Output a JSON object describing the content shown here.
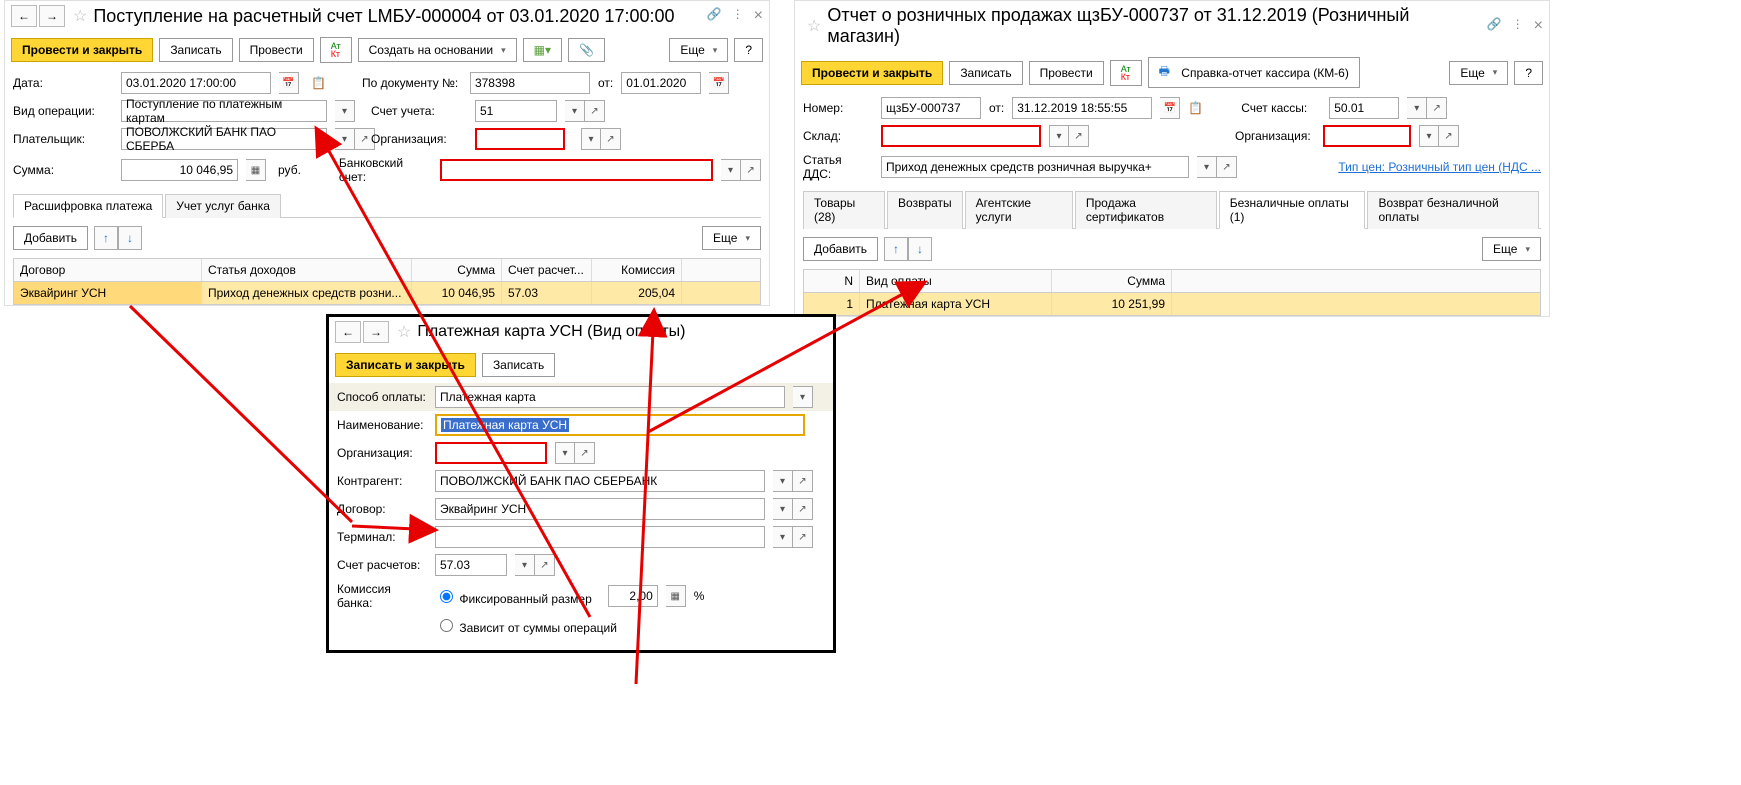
{
  "left": {
    "title": "Поступление на расчетный счет LMБУ-000004 от 03.01.2020 17:00:00",
    "toolbar": {
      "post_close": "Провести и закрыть",
      "write": "Записать",
      "post": "Провести",
      "create_based": "Создать на основании",
      "more": "Еще",
      "help": "?"
    },
    "fields": {
      "date_label": "Дата:",
      "date": "03.01.2020 17:00:00",
      "docnum_label": "По документу №:",
      "docnum": "378398",
      "docfrom_label": "от:",
      "docfrom": "01.01.2020",
      "optype_label": "Вид операции:",
      "optype": "Поступление по платежным картам",
      "acct_label": "Счет учета:",
      "acct": "51",
      "payer_label": "Плательщик:",
      "payer": "ПОВОЛЖСКИЙ БАНК ПАО СБЕРБА",
      "org_label": "Организация:",
      "amount_label": "Сумма:",
      "amount": "10 046,95",
      "currency": "руб.",
      "bankacc_label": "Банковский счет:"
    },
    "tabs": {
      "t1": "Расшифровка платежа",
      "t2": "Учет услуг банка"
    },
    "subbar": {
      "add": "Добавить",
      "more": "Еще"
    },
    "table": {
      "h1": "Договор",
      "h2": "Статья доходов",
      "h3": "Сумма",
      "h4": "Счет расчет...",
      "h5": "Комиссия",
      "r1": {
        "dog": "Эквайринг УСН",
        "st": "Приход денежных средств розни...",
        "sum": "10 046,95",
        "acc": "57.03",
        "kom": "205,04"
      }
    }
  },
  "right": {
    "title": "Отчет о розничных продажах щзБУ-000737 от 31.12.2019 (Розничный магазин)",
    "toolbar": {
      "post_close": "Провести и закрыть",
      "write": "Записать",
      "post": "Провести",
      "report": "Справка-отчет кассира (КМ-6)",
      "more": "Еще",
      "help": "?"
    },
    "fields": {
      "num_label": "Номер:",
      "num": "щзБУ-000737",
      "from_label": "от:",
      "from": "31.12.2019 18:55:55",
      "cash_label": "Счет кассы:",
      "cash": "50.01",
      "warehouse_label": "Склад:",
      "org_label": "Организация:",
      "dds_label": "Статья ДДС:",
      "dds": "Приход денежных средств розничная выручка+",
      "pricetype": "Тип цен: Розничный тип цен (НДС ..."
    },
    "tabs": {
      "t1": "Товары (28)",
      "t2": "Возвраты",
      "t3": "Агентские услуги",
      "t4": "Продажа сертификатов",
      "t5": "Безналичные оплаты (1)",
      "t6": "Возврат безналичной оплаты"
    },
    "subbar": {
      "add": "Добавить",
      "more": "Еще"
    },
    "table": {
      "h1": "N",
      "h2": "Вид оплаты",
      "h3": "Сумма",
      "r1": {
        "n": "1",
        "type": "Платежная карта УСН",
        "sum": "10 251,99"
      }
    }
  },
  "popup": {
    "title": "Платежная карта УСН (Вид оплаты)",
    "toolbar": {
      "write_close": "Записать и закрыть",
      "write": "Записать"
    },
    "fields": {
      "method_label": "Способ оплаты:",
      "method": "Платежная карта",
      "name_label": "Наименование:",
      "name": "Платежная карта УСН",
      "org_label": "Организация:",
      "contractor_label": "Контрагент:",
      "contractor": "ПОВОЛЖСКИЙ БАНК ПАО СБЕРБАНК",
      "contract_label": "Договор:",
      "contract": "Эквайринг УСН",
      "terminal_label": "Терминал:",
      "acct_label": "Счет расчетов:",
      "acct": "57.03",
      "commission_label": "Комиссия банка:",
      "commission_fixed": "Фиксированный размер",
      "commission_val": "2,00",
      "commission_pct": "%",
      "commission_dep": "Зависит от суммы операций"
    }
  }
}
